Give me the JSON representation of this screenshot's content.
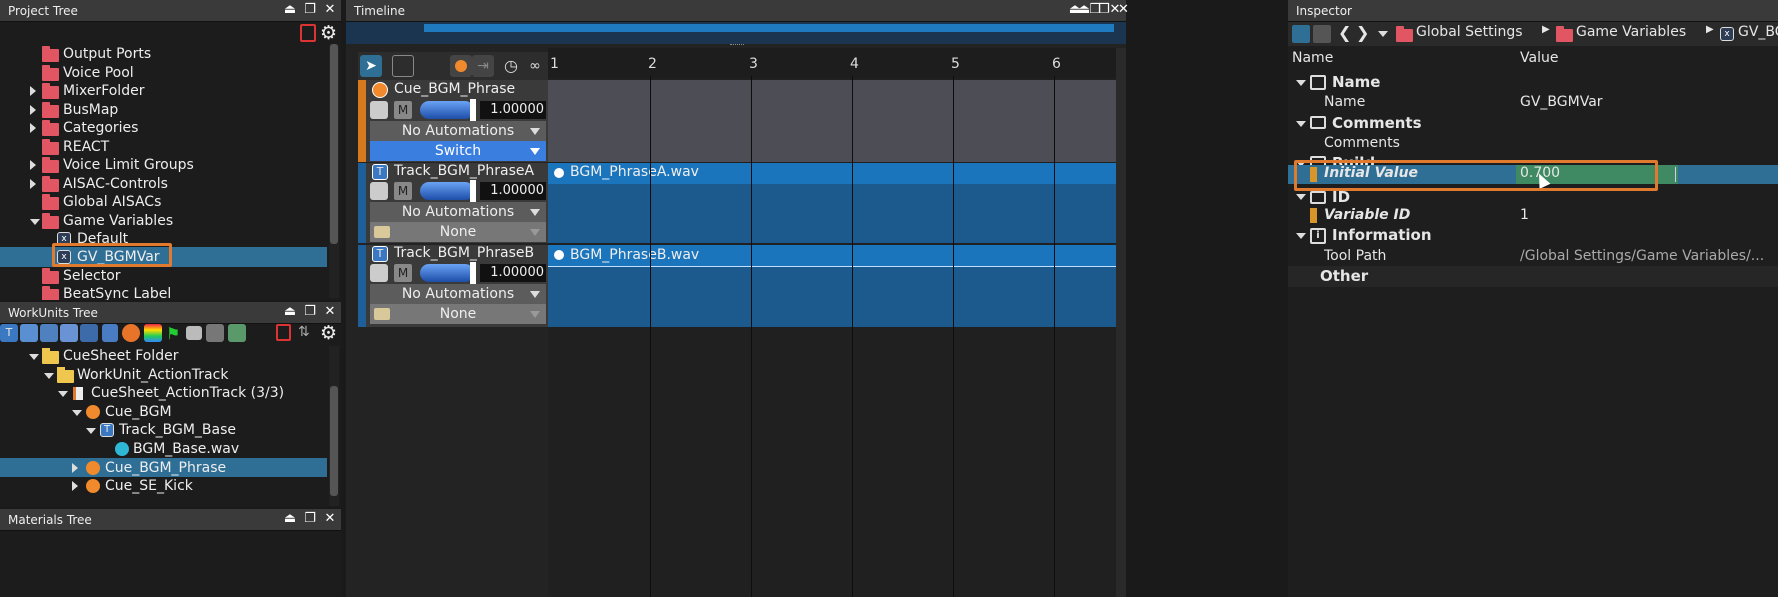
{
  "project_tree": {
    "title": "Project Tree",
    "items": [
      {
        "label": "Output Ports"
      },
      {
        "label": "Voice Pool"
      },
      {
        "label": "MixerFolder"
      },
      {
        "label": "BusMap"
      },
      {
        "label": "Categories"
      },
      {
        "label": "REACT"
      },
      {
        "label": "Voice Limit Groups"
      },
      {
        "label": "AISAC-Controls"
      },
      {
        "label": "Global AISACs"
      },
      {
        "label": "Game Variables"
      },
      {
        "label": "Default"
      },
      {
        "label": "GV_BGMVar"
      },
      {
        "label": "Selector"
      },
      {
        "label": "BeatSync Label"
      }
    ]
  },
  "workunits_tree": {
    "title": "WorkUnits Tree",
    "items": [
      {
        "label": "CueSheet Folder"
      },
      {
        "label": "WorkUnit_ActionTrack"
      },
      {
        "label": "CueSheet_ActionTrack (3/3)"
      },
      {
        "label": "Cue_BGM"
      },
      {
        "label": "Track_BGM_Base"
      },
      {
        "label": "BGM_Base.wav"
      },
      {
        "label": "Cue_BGM_Phrase"
      },
      {
        "label": "Cue_SE_Kick"
      }
    ]
  },
  "materials_tree": {
    "title": "Materials Tree"
  },
  "timeline": {
    "title": "Timeline",
    "ruler": [
      "1",
      "2",
      "3",
      "4",
      "5",
      "6"
    ],
    "tracks": [
      {
        "name": "Cue_BGM_Phrase",
        "volume": "1.00000",
        "automation": "No Automations",
        "mode": "Switch",
        "mute": "M"
      },
      {
        "name": "Track_BGM_PhraseA",
        "volume": "1.00000",
        "automation": "No Automations",
        "mode": "None",
        "mute": "M",
        "clip": "BGM_PhraseA.wav"
      },
      {
        "name": "Track_BGM_PhraseB",
        "volume": "1.00000",
        "automation": "No Automations",
        "mode": "None",
        "mute": "M",
        "clip": "BGM_PhraseB.wav"
      }
    ]
  },
  "inspector": {
    "title": "Inspector",
    "breadcrumb": [
      "Global Settings",
      "Game Variables",
      "GV_BGI"
    ],
    "col_name": "Name",
    "col_value": "Value",
    "sections": {
      "name": {
        "title": "Name",
        "prop": "Name",
        "value": "GV_BGMVar"
      },
      "comments": {
        "title": "Comments",
        "prop": "Comments",
        "value": ""
      },
      "build": {
        "title": "Build",
        "prop": "Initial Value",
        "value": "0.700"
      },
      "id": {
        "title": "ID",
        "prop": "Variable ID",
        "value": "1"
      },
      "information": {
        "title": "Information",
        "prop": "Tool Path",
        "value": "/Global Settings/Game Variables/..."
      },
      "other": {
        "title": "Other"
      }
    }
  },
  "colors": {
    "accent_selection": "#2f6f96",
    "highlight_box": "#e07a2f",
    "clip_blue": "#1b75bd",
    "value_bar": "#3f8a63"
  }
}
